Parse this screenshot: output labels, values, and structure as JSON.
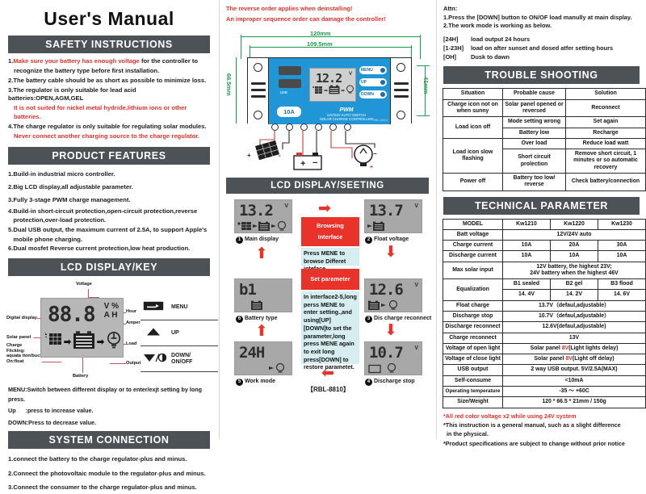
{
  "title": "User's Manual",
  "left": {
    "safety_header": "SAFETY INSTRUCTIONS",
    "safety_items": [
      {
        "num": "1.",
        "red_lead": "Make sure your battery has enough voltage",
        "rest": " for the controller to",
        "line2": "recognize the battery type before first installation."
      },
      {
        "num": "2.",
        "plain": "The battery cable should be as short as possible to minimize loss."
      },
      {
        "num": "3.",
        "plain": "The regulator is only suitable for lead acid batteries:OPEN,AGM,GEL",
        "red_line2": "It is not suited for nickel metal hydride,lithium ions or other batteries."
      },
      {
        "num": "4.",
        "plain": "The charge regulator is only suitable for regulating solar modules.",
        "red_line2": "Never connect another charging source to the charge regulator."
      }
    ],
    "features_header": "PRODUCT FEATURES",
    "features": [
      "1.Build-in industrial micro controller.",
      "2.Big LCD display,all adjustable parameter.",
      "3.Fully 3-stage PWM charge management.",
      "4.Build-in short-circuit protection,open-circuit protection,reverse",
      "   protection,over-load protection.",
      "5.Dual USB output, the maximum current of 2.5A, to support Apple's",
      "   mobile phone charging.",
      "6.Dual mosfet Reverse current protection,low heat production."
    ],
    "lcdkey_header": "LCD DISPLAY/KEY",
    "lcd_digits": "88.8",
    "lcd_unit_top": "V %",
    "lcd_unit_bottom": "A H",
    "callouts": {
      "voltage": "Voltage",
      "digital_display": "Digital display",
      "solar_panel": "Solar panel",
      "charge_flicking": "Charge\nFlicking:\naquata tion/buck\nOn:float",
      "battery": "Battery",
      "hour": "Hour",
      "amper": "Amper",
      "load": "Load",
      "output": "Output"
    },
    "keys": [
      {
        "glyph": "menu-key-icon",
        "label": "MENU"
      },
      {
        "glyph": "up-key-icon",
        "label": "UP"
      },
      {
        "glyph": "down-key-icon",
        "label": "DOWN/\nON/OFF"
      }
    ],
    "key_help": [
      "MENU:Switch between different display or to enter/exjt setting by long press.",
      "Up      :press to increase value.",
      "DOWN:Press to decrease value."
    ],
    "system_header": "SYSTEM CONNECTION",
    "system_items": [
      "1.connect the battery to the charge regulator-plus and minus.",
      "2.Connect the photovoltaic module to the regulator-plus and minus.",
      "3.Connect the consumer to the charge regulator-plus and minus."
    ]
  },
  "middle": {
    "warnings": [
      "The reverse order applies when deinstalling!",
      "An improper sequence order can damage the controller!"
    ],
    "dims": {
      "width_outer": "120mm",
      "width_inner": "109.5mm",
      "height_outer": "66.5mm",
      "height_inner": "41mm"
    },
    "device": {
      "lcd_value": "12.2",
      "lcd_unit": "V",
      "amp_badge": "10A",
      "usb_label": "USB",
      "pwm": "PWM",
      "sub1": "12V/24V AUTO SWITCH",
      "sub2": "SOLAR CHARGE CONTROLLER",
      "model_mark": "RBL-8810",
      "keys": [
        "MENU",
        "UP",
        "DOWN"
      ]
    },
    "lcd_setting_header": "LCD DISPLAY/SEETING",
    "screens": [
      {
        "id": 1,
        "value": "13.2",
        "unit": "V",
        "caption": "Main display",
        "icons": "solar-battery-load"
      },
      {
        "id": 2,
        "value": "13.7",
        "unit": "V",
        "caption": "Float voltage",
        "icons": "battery"
      },
      {
        "id": 3,
        "value": "12.6",
        "unit": "V",
        "caption": "Dis charge reconnect",
        "icons": "battery-load"
      },
      {
        "id": 4,
        "value": "10.7",
        "unit": "V",
        "caption": "Discharge stop",
        "icons": "empty-battery-load"
      },
      {
        "id": 5,
        "value": "24H",
        "unit": "",
        "caption": "Work mode",
        "icons": "load"
      },
      {
        "id": 6,
        "value": "b1",
        "unit": "",
        "caption": "Battery type",
        "icons": "battery"
      }
    ],
    "browsing_box": [
      "Browsing",
      "Interface"
    ],
    "browsing_note": "Press MENE to browse Differet inteface.",
    "setparam_box": [
      "Set parameter"
    ],
    "setparam_note": "In interface2-5,long perss MENE to enter setting.,and using[UP][DOWN]to set the parameter,long press MENE again to exit long press[DOWN] to restore parametet.",
    "model_caption": "【RBL-8810】"
  },
  "right": {
    "attn_title": "Attn:",
    "attn_items": [
      "1.Press the [DOWN] button to ON/OF load manully at main display.",
      "2.The work mode is working as below."
    ],
    "modes": [
      {
        "key": "[24H]",
        "desc": "load output 24 hours"
      },
      {
        "key": "[1-23H]",
        "desc": "load on after sunset and dosed atfer setting hours"
      },
      {
        "key": "[OH]",
        "desc": "Dusk to dawn"
      }
    ],
    "trouble_header": "TROUBLE SHOOTING",
    "trouble_columns": [
      "Situation",
      "Probable cause",
      "Solution"
    ],
    "trouble_rows": [
      {
        "situation": "Charge icon not on when sunny",
        "cause": "Solar panel opened or reversed",
        "solution": "Reconnect",
        "rowspan": 1
      },
      {
        "situation": "Load icon off",
        "cause": "Mode setting wrong",
        "solution": "Set again",
        "rowspan": 2
      },
      {
        "situation": "",
        "cause": "Battery low",
        "solution": "Recharge"
      },
      {
        "situation": "Load icon slow flashing",
        "cause": "Over load",
        "solution": "Reduce load watt",
        "rowspan": 2
      },
      {
        "situation": "",
        "cause": "Short circuit prolection",
        "solution": "Remove short circuit, 1 minutes or so automatic recovery"
      },
      {
        "situation": "Power off",
        "cause": "Battery too low/ reverse",
        "solution": "Check battery/connection",
        "rowspan": 1
      }
    ],
    "tech_header": "TECHNICAL PARAMETER",
    "tech_models": [
      "MODEL",
      "Kw1210",
      "Kw1220",
      "Kw1230"
    ],
    "tech_rows": [
      {
        "label": "Batt voltage",
        "span": "12V/24V  auto"
      },
      {
        "label": "Charge current",
        "cells": [
          "10A",
          "20A",
          "30A"
        ]
      },
      {
        "label": "Discharge current",
        "cells": [
          "10A",
          "10A",
          "10A"
        ]
      },
      {
        "label": "Max solar input",
        "span": "12V battery, the highest 23V;\n24V battery when the highest 46V"
      },
      {
        "label": "Equalization",
        "cells_a": [
          "B1 sealed",
          "B2 gel",
          "B3 flood"
        ],
        "cells_b": [
          "14. 4V",
          "14. 2V",
          "14. 6V"
        ]
      },
      {
        "label": "Float charge",
        "span": "13.7V（defaul,adjustable）",
        "red": true
      },
      {
        "label": "Discharge stop",
        "span": "10.7V（defaul,adjustable）",
        "red": true
      },
      {
        "label": "Discharge reconnect",
        "span": "12.6V(defaul,adjustable)",
        "red": true
      },
      {
        "label": "Charge reconnect",
        "span": "13V",
        "red": true
      },
      {
        "label": "Voltage of open light",
        "span_pre": "Solar panel ",
        "span_red": "8V",
        "span_post": "(Light lights delay)"
      },
      {
        "label": "Voltage of close light",
        "span_pre": "Solar panel ",
        "span_red": "8V",
        "span_post": "(Light off delay)"
      },
      {
        "label": "USB output",
        "span": "2 way USB output.  5V/2.5A(MAX)"
      },
      {
        "label": "Self-consume",
        "span": "<10mA"
      },
      {
        "label": "Operating temperature",
        "span": "-35 ～ +60C"
      },
      {
        "label": "Size/Weight",
        "span": "120 * 66.5 * 21mm  /  150g"
      }
    ],
    "footnotes": [
      {
        "text": "*All red color voltage x2 while using 24V system",
        "red": true
      },
      {
        "text": "*This instruction is a general manual, such as a slight difference",
        "red": false
      },
      {
        "text": "  in the physical.",
        "red": false
      },
      {
        "text": "*Product specifications are subject to change without prior notice",
        "red": false
      }
    ]
  }
}
